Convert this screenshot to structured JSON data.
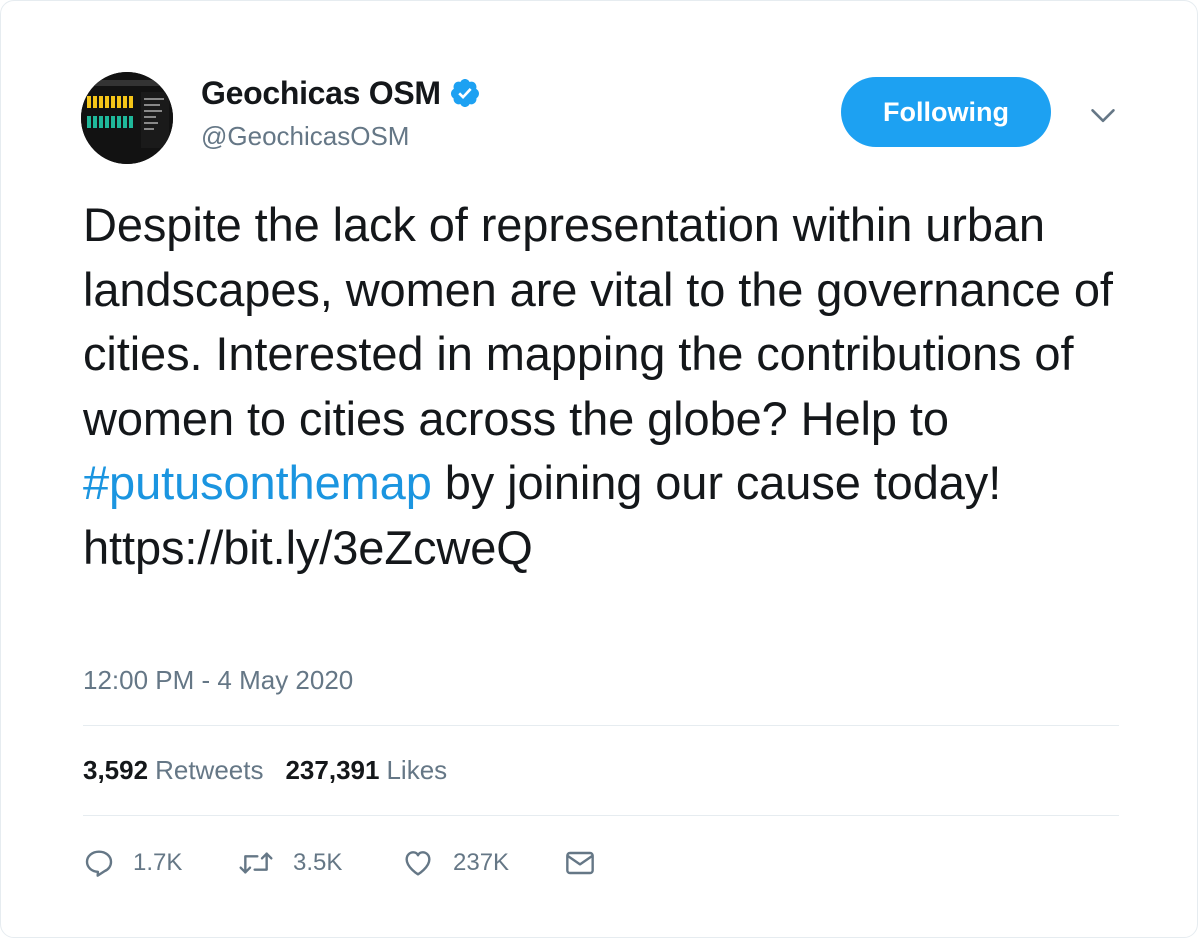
{
  "author": {
    "display_name": "Geochicas OSM",
    "handle": "@GeochicasOSM",
    "verified": true
  },
  "follow_button": {
    "label": "Following"
  },
  "tweet": {
    "text_before": "Despite the lack of representation within urban landscapes, women are vital to the governance of cities. Interested in mapping the contributions of women to cities across the globe?  Help to ",
    "hashtag": "#putusonthemap",
    "text_after": " by joining our cause today! https://bit.ly/3eZcweQ",
    "timestamp": "12:00 PM - 4 May 2020"
  },
  "stats": {
    "retweets_count": "3,592",
    "retweets_label": "Retweets",
    "likes_count": "237,391",
    "likes_label": "Likes"
  },
  "actions": {
    "reply_count": "1.7K",
    "retweet_count": "3.5K",
    "like_count": "237K"
  },
  "colors": {
    "accent": "#1da1f2",
    "hashtag": "#1b95e0",
    "secondary_text": "#657786",
    "primary_text": "#14171a",
    "divider": "#e6ecf0"
  }
}
